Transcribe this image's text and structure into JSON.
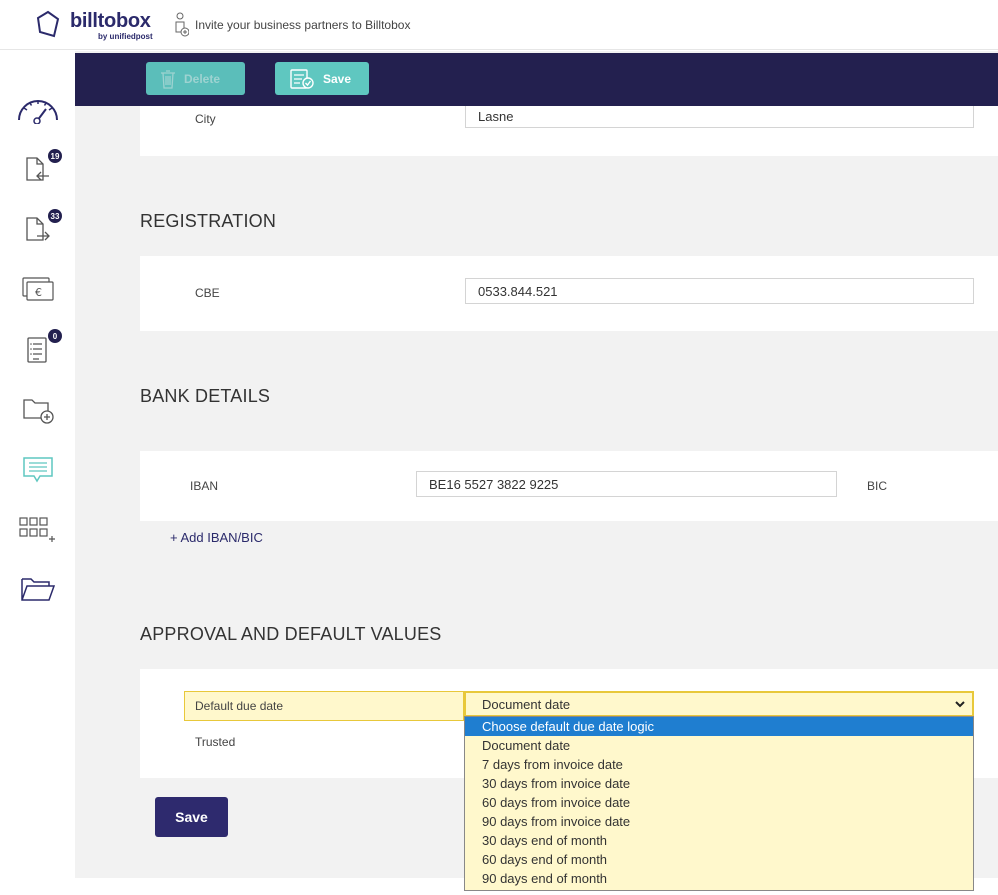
{
  "header": {
    "brand": "billtobox",
    "brand_sub": "by unifiedpost",
    "invite_text": "Invite your business partners to Billtobox"
  },
  "sidebar": {
    "items": [
      {
        "name": "dashboard",
        "icon": "speedometer-icon"
      },
      {
        "name": "incoming-documents",
        "icon": "document-in-icon",
        "badge": "19"
      },
      {
        "name": "outgoing-documents",
        "icon": "document-out-icon",
        "badge": "33"
      },
      {
        "name": "payments",
        "icon": "euro-cards-icon"
      },
      {
        "name": "tasks",
        "icon": "clipboard-list-icon",
        "badge": "0"
      },
      {
        "name": "add-folder",
        "icon": "folder-add-icon"
      },
      {
        "name": "messages",
        "icon": "chat-icon"
      },
      {
        "name": "apps",
        "icon": "grid-add-icon"
      },
      {
        "name": "archive",
        "icon": "folder-open-icon"
      }
    ]
  },
  "toolbar": {
    "delete_label": "Delete",
    "save_label": "Save"
  },
  "address": {
    "city_label": "City",
    "city_value": "Lasne"
  },
  "registration": {
    "title": "REGISTRATION",
    "cbe_label": "CBE",
    "cbe_value": "0533.844.521"
  },
  "bank": {
    "title": "BANK DETAILS",
    "iban_label": "IBAN",
    "iban_value": "BE16 5527 3822 9225",
    "bic_label": "BIC",
    "add_link": "+ Add IBAN/BIC"
  },
  "approval": {
    "title": "APPROVAL AND DEFAULT VALUES",
    "due_date_label": "Default due date",
    "due_date_value": "Document date",
    "trusted_label": "Trusted",
    "options": [
      "Choose default due date logic",
      "Document date",
      "7 days from invoice date",
      "30 days from invoice date",
      "60 days from invoice date",
      "90 days from invoice date",
      "30 days end of month",
      "60 days end of month",
      "90 days end of month"
    ],
    "highlighted_option": "Choose default due date logic"
  },
  "footer": {
    "save_label": "Save"
  },
  "colors": {
    "brand_navy": "#23204f",
    "teal": "#5fc7c0",
    "highlight_yellow": "#fff8cc",
    "highlight_border": "#e8c83a",
    "selected_blue": "#1f7ed0"
  }
}
